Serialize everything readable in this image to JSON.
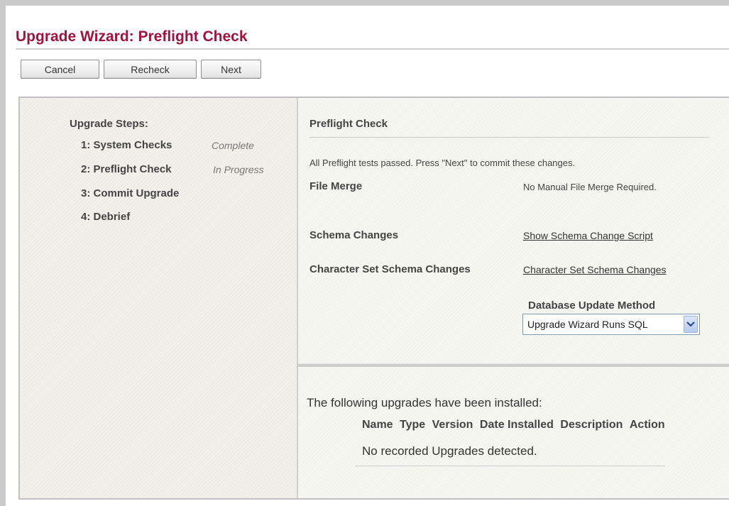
{
  "page": {
    "title": "Upgrade Wizard: Preflight Check"
  },
  "toolbar": {
    "cancel_label": "Cancel",
    "recheck_label": "Recheck",
    "next_label": "Next"
  },
  "steps": {
    "heading": "Upgrade Steps:",
    "items": [
      {
        "label": "1: System Checks",
        "status": "Complete"
      },
      {
        "label": "2: Preflight Check",
        "status": "In Progress"
      },
      {
        "label": "3: Commit Upgrade",
        "status": ""
      },
      {
        "label": "4: Debrief",
        "status": ""
      }
    ]
  },
  "preflight": {
    "title": "Preflight Check",
    "message": "All Preflight tests passed. Press \"Next\" to commit these changes.",
    "file_merge": {
      "label": "File Merge",
      "value": "No Manual File Merge Required."
    },
    "schema_changes": {
      "label": "Schema Changes",
      "link": "Show Schema Change Script"
    },
    "charset_changes": {
      "label": "Character Set Schema Changes",
      "link": "Character Set Schema Changes"
    },
    "db_update": {
      "label": "Database Update Method",
      "selected": "Upgrade Wizard Runs SQL"
    }
  },
  "installed": {
    "message": "The following upgrades have been installed:",
    "columns": [
      "Name",
      "Type",
      "Version",
      "Date Installed",
      "Description",
      "Action"
    ],
    "empty_message": "No recorded Upgrades detected."
  },
  "colors": {
    "title": "#a3123d"
  },
  "icons": {
    "select_arrow": "chevron-down-icon"
  }
}
